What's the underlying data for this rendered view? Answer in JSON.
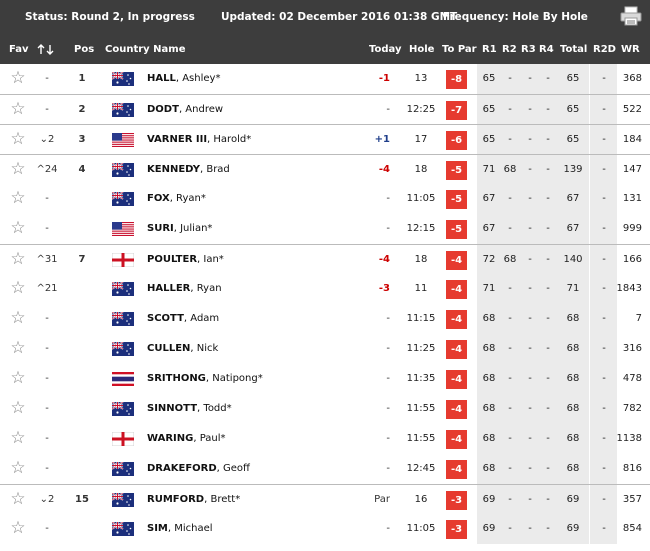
{
  "status_bar": {
    "status": "Status: Round 2, In progress",
    "updated": "Updated: 02 December 2016 01:38 GMT",
    "frequency": "Frequency: Hole By Hole"
  },
  "columns": {
    "fav": "Fav",
    "pos": "Pos",
    "country_name": "Country Name",
    "today": "Today",
    "hole": "Hole",
    "to_par": "To Par",
    "r1": "R1",
    "r2": "R2",
    "r3": "R3",
    "r4": "R4",
    "total": "Total",
    "r2d": "R2D",
    "wr": "WR"
  },
  "icons": {
    "star": "star-outline-icon",
    "sort": "sort-arrows-icon",
    "printer": "printer-icon"
  },
  "colors": {
    "header_bg": "#3d3d3d",
    "to_par_badge": "#e63a2f",
    "today_over": "#cc0000",
    "today_under": "#1f3e8a"
  },
  "players": [
    {
      "move": "-",
      "pos": "1",
      "flag": "aus",
      "last": "HALL",
      "first": "Ashley*",
      "today": "-1",
      "today_style": "red",
      "hole": "13",
      "to_par": "-8",
      "r1": "65",
      "r2": "-",
      "r3": "-",
      "r4": "-",
      "total": "65",
      "r2d": "-",
      "wr": "368",
      "sep": false
    },
    {
      "move": "-",
      "pos": "2",
      "flag": "aus",
      "last": "DODT",
      "first": "Andrew",
      "today": "-",
      "today_style": "dash",
      "hole": "12:25",
      "to_par": "-7",
      "r1": "65",
      "r2": "-",
      "r3": "-",
      "r4": "-",
      "total": "65",
      "r2d": "-",
      "wr": "522",
      "sep": true
    },
    {
      "move": "⌄2",
      "pos": "3",
      "flag": "usa",
      "last": "VARNER III",
      "first": "Harold*",
      "today": "+1",
      "today_style": "blue",
      "hole": "17",
      "to_par": "-6",
      "r1": "65",
      "r2": "-",
      "r3": "-",
      "r4": "-",
      "total": "65",
      "r2d": "-",
      "wr": "184",
      "sep": true
    },
    {
      "move": "^24",
      "pos": "4",
      "flag": "aus",
      "last": "KENNEDY",
      "first": "Brad",
      "today": "-4",
      "today_style": "red",
      "hole": "18",
      "to_par": "-5",
      "r1": "71",
      "r2": "68",
      "r3": "-",
      "r4": "-",
      "total": "139",
      "r2d": "-",
      "wr": "147",
      "sep": true
    },
    {
      "move": "-",
      "pos": "",
      "flag": "aus",
      "last": "FOX",
      "first": "Ryan*",
      "today": "-",
      "today_style": "dash",
      "hole": "11:05",
      "to_par": "-5",
      "r1": "67",
      "r2": "-",
      "r3": "-",
      "r4": "-",
      "total": "67",
      "r2d": "-",
      "wr": "131",
      "sep": false
    },
    {
      "move": "-",
      "pos": "",
      "flag": "usa",
      "last": "SURI",
      "first": "Julian*",
      "today": "-",
      "today_style": "dash",
      "hole": "12:15",
      "to_par": "-5",
      "r1": "67",
      "r2": "-",
      "r3": "-",
      "r4": "-",
      "total": "67",
      "r2d": "-",
      "wr": "999",
      "sep": false
    },
    {
      "move": "^31",
      "pos": "7",
      "flag": "eng",
      "last": "POULTER",
      "first": "Ian*",
      "today": "-4",
      "today_style": "red",
      "hole": "18",
      "to_par": "-4",
      "r1": "72",
      "r2": "68",
      "r3": "-",
      "r4": "-",
      "total": "140",
      "r2d": "-",
      "wr": "166",
      "sep": true
    },
    {
      "move": "^21",
      "pos": "",
      "flag": "aus",
      "last": "HALLER",
      "first": "Ryan",
      "today": "-3",
      "today_style": "red",
      "hole": "11",
      "to_par": "-4",
      "r1": "71",
      "r2": "-",
      "r3": "-",
      "r4": "-",
      "total": "71",
      "r2d": "-",
      "wr": "1843",
      "sep": false
    },
    {
      "move": "-",
      "pos": "",
      "flag": "aus",
      "last": "SCOTT",
      "first": "Adam",
      "today": "-",
      "today_style": "dash",
      "hole": "11:15",
      "to_par": "-4",
      "r1": "68",
      "r2": "-",
      "r3": "-",
      "r4": "-",
      "total": "68",
      "r2d": "-",
      "wr": "7",
      "sep": false
    },
    {
      "move": "-",
      "pos": "",
      "flag": "aus",
      "last": "CULLEN",
      "first": "Nick",
      "today": "-",
      "today_style": "dash",
      "hole": "11:25",
      "to_par": "-4",
      "r1": "68",
      "r2": "-",
      "r3": "-",
      "r4": "-",
      "total": "68",
      "r2d": "-",
      "wr": "316",
      "sep": false
    },
    {
      "move": "-",
      "pos": "",
      "flag": "tha",
      "last": "SRITHONG",
      "first": "Natipong*",
      "today": "-",
      "today_style": "dash",
      "hole": "11:35",
      "to_par": "-4",
      "r1": "68",
      "r2": "-",
      "r3": "-",
      "r4": "-",
      "total": "68",
      "r2d": "-",
      "wr": "478",
      "sep": false
    },
    {
      "move": "-",
      "pos": "",
      "flag": "aus",
      "last": "SINNOTT",
      "first": "Todd*",
      "today": "-",
      "today_style": "dash",
      "hole": "11:55",
      "to_par": "-4",
      "r1": "68",
      "r2": "-",
      "r3": "-",
      "r4": "-",
      "total": "68",
      "r2d": "-",
      "wr": "782",
      "sep": false
    },
    {
      "move": "-",
      "pos": "",
      "flag": "eng",
      "last": "WARING",
      "first": "Paul*",
      "today": "-",
      "today_style": "dash",
      "hole": "11:55",
      "to_par": "-4",
      "r1": "68",
      "r2": "-",
      "r3": "-",
      "r4": "-",
      "total": "68",
      "r2d": "-",
      "wr": "1138",
      "sep": false
    },
    {
      "move": "-",
      "pos": "",
      "flag": "aus",
      "last": "DRAKEFORD",
      "first": "Geoff",
      "today": "-",
      "today_style": "dash",
      "hole": "12:45",
      "to_par": "-4",
      "r1": "68",
      "r2": "-",
      "r3": "-",
      "r4": "-",
      "total": "68",
      "r2d": "-",
      "wr": "816",
      "sep": false
    },
    {
      "move": "⌄2",
      "pos": "15",
      "flag": "aus",
      "last": "RUMFORD",
      "first": "Brett*",
      "today": "Par",
      "today_style": "dash",
      "hole": "16",
      "to_par": "-3",
      "r1": "69",
      "r2": "-",
      "r3": "-",
      "r4": "-",
      "total": "69",
      "r2d": "-",
      "wr": "357",
      "sep": true
    },
    {
      "move": "-",
      "pos": "",
      "flag": "aus",
      "last": "SIM",
      "first": "Michael",
      "today": "-",
      "today_style": "dash",
      "hole": "11:05",
      "to_par": "-3",
      "r1": "69",
      "r2": "-",
      "r3": "-",
      "r4": "-",
      "total": "69",
      "r2d": "-",
      "wr": "854",
      "sep": false
    }
  ]
}
